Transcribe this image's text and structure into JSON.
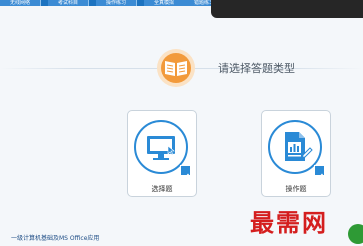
{
  "top_tabs": [
    "无线网络",
    "考试科目",
    "操作练习",
    "全真模拟",
    "错题练习"
  ],
  "prompt": "请选择答题类型",
  "cards": [
    {
      "label": "选择题",
      "icon": "monitor-cursor-icon",
      "checked": true
    },
    {
      "label": "操作题",
      "icon": "document-pen-icon",
      "checked": true
    }
  ],
  "footer": "一级计算机基础及MS Office应用",
  "watermark": "最需网",
  "colors": {
    "accent": "#2a8ad6",
    "brand_orange": "#f29a3b",
    "topbar": "#1c73c0",
    "watermark": "#d41e1e"
  }
}
